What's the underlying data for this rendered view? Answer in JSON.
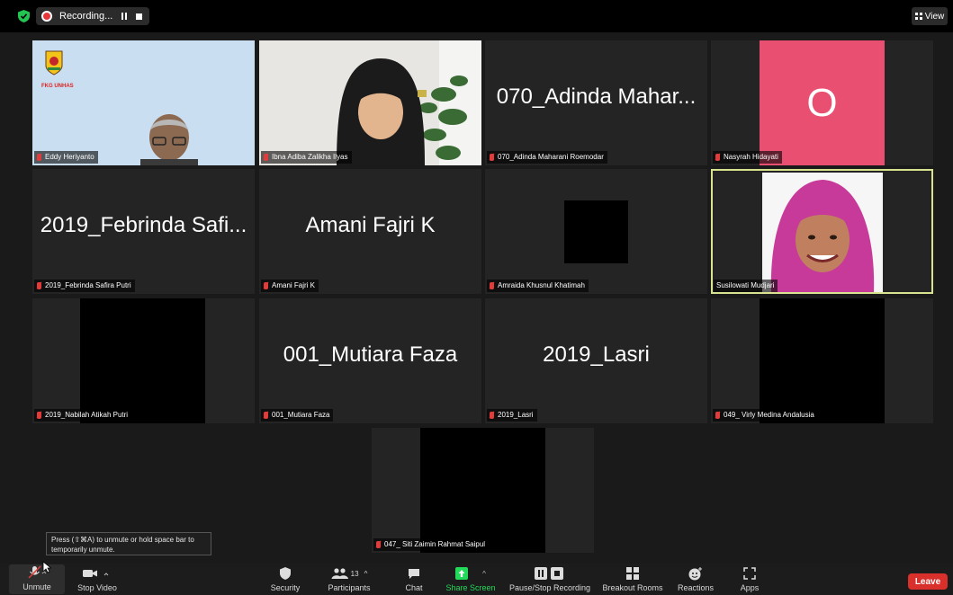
{
  "topbar": {
    "recording_label": "Recording...",
    "view_label": "View"
  },
  "tiles": [
    {
      "name": "Eddy Heriyanto"
    },
    {
      "name": "Ibna Adiba Zalikha Ilyas"
    },
    {
      "name": "070_Adinda Maharani Roemodar",
      "big": "070_Adinda Mahar..."
    },
    {
      "name": "Nasyrah Hidayati",
      "initial": "O"
    },
    {
      "name": "2019_Febrinda Safira Putri",
      "big": "2019_Febrinda Safi..."
    },
    {
      "name": "Amani Fajri K",
      "big": "Amani Fajri K"
    },
    {
      "name": "Amraida Khusnul Khatimah"
    },
    {
      "name": "Susilowati Mudjari"
    },
    {
      "name": "2019_Nabilah Atikah Putri"
    },
    {
      "name": "001_Mutiara Faza",
      "big": "001_Mutiara Faza"
    },
    {
      "name": "2019_Lasri",
      "big": "2019_Lasri"
    },
    {
      "name": "049_ Virly Medina Andalusia"
    },
    {
      "name": "047_ Siti Zaimin Rahmat Saipul"
    }
  ],
  "logo_text": "FKG UNHAS",
  "tooltip": "Press (⇧⌘A) to unmute or hold space bar to temporarily unmute.",
  "toolbar": {
    "unmute": "Unmute",
    "stop_video": "Stop Video",
    "security": "Security",
    "participants": "Participants",
    "participant_count": "13",
    "chat": "Chat",
    "share_screen": "Share Screen",
    "pause_stop_recording": "Pause/Stop Recording",
    "breakout_rooms": "Breakout Rooms",
    "reactions": "Reactions",
    "apps": "Apps",
    "leave": "Leave"
  },
  "colors": {
    "active_speaker_border": "#d9e38f",
    "share_screen": "#23d959",
    "leave": "#d9302b",
    "avatar_bg": "#e94f70"
  }
}
